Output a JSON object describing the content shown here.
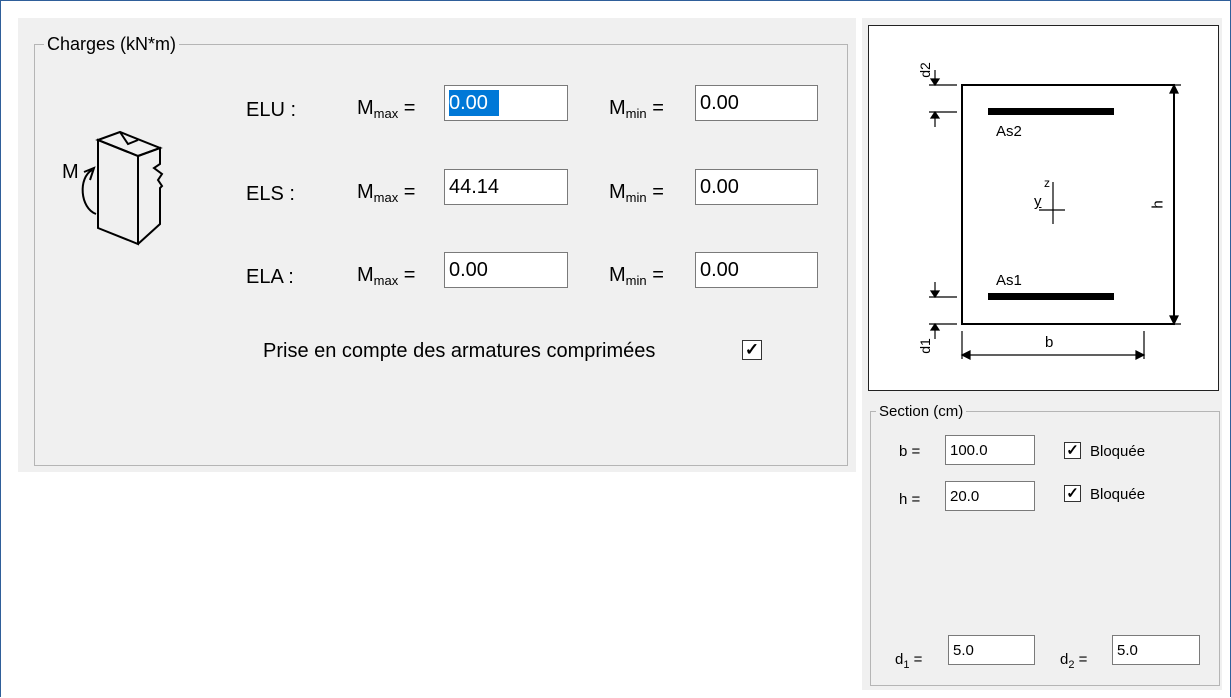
{
  "charges": {
    "title": "Charges (kN*m)",
    "moment_label": "M",
    "rows": [
      {
        "name": "ELU :",
        "mmax_label": "M",
        "mmax_sub": "max",
        "mmax_eq": "=",
        "mmax_value": "0.00",
        "mmin_label": "M",
        "mmin_sub": "min",
        "mmin_eq": "=",
        "mmin_value": "0.00"
      },
      {
        "name": "ELS :",
        "mmax_label": "M",
        "mmax_sub": "max",
        "mmax_eq": "=",
        "mmax_value": "44.14",
        "mmin_label": "M",
        "mmin_sub": "min",
        "mmin_eq": "=",
        "mmin_value": "0.00"
      },
      {
        "name": "ELA :",
        "mmax_label": "M",
        "mmax_sub": "max",
        "mmax_eq": "=",
        "mmax_value": "0.00",
        "mmin_label": "M",
        "mmin_sub": "min",
        "mmin_eq": "=",
        "mmin_value": "0.00"
      }
    ],
    "compressed_label": "Prise en compte des armatures comprimées",
    "compressed_checked": "✓"
  },
  "diagram": {
    "d2": "d2",
    "d1": "d1",
    "as2": "As2",
    "as1": "As1",
    "y": "y",
    "z": "z",
    "h": "h",
    "b": "b"
  },
  "section": {
    "title": "Section (cm)",
    "b_label": "b =",
    "b_value": "100.0",
    "b_lock_label": "Bloquée",
    "h_label": "h =",
    "h_value": "20.0",
    "h_lock_label": "Bloquée",
    "lock_checked": "✓",
    "d1_label": "d",
    "d1_sub": "1",
    "d1_eq": "=",
    "d1_value": "5.0",
    "d2_label": "d",
    "d2_sub": "2",
    "d2_eq": "=",
    "d2_value": "5.0"
  }
}
